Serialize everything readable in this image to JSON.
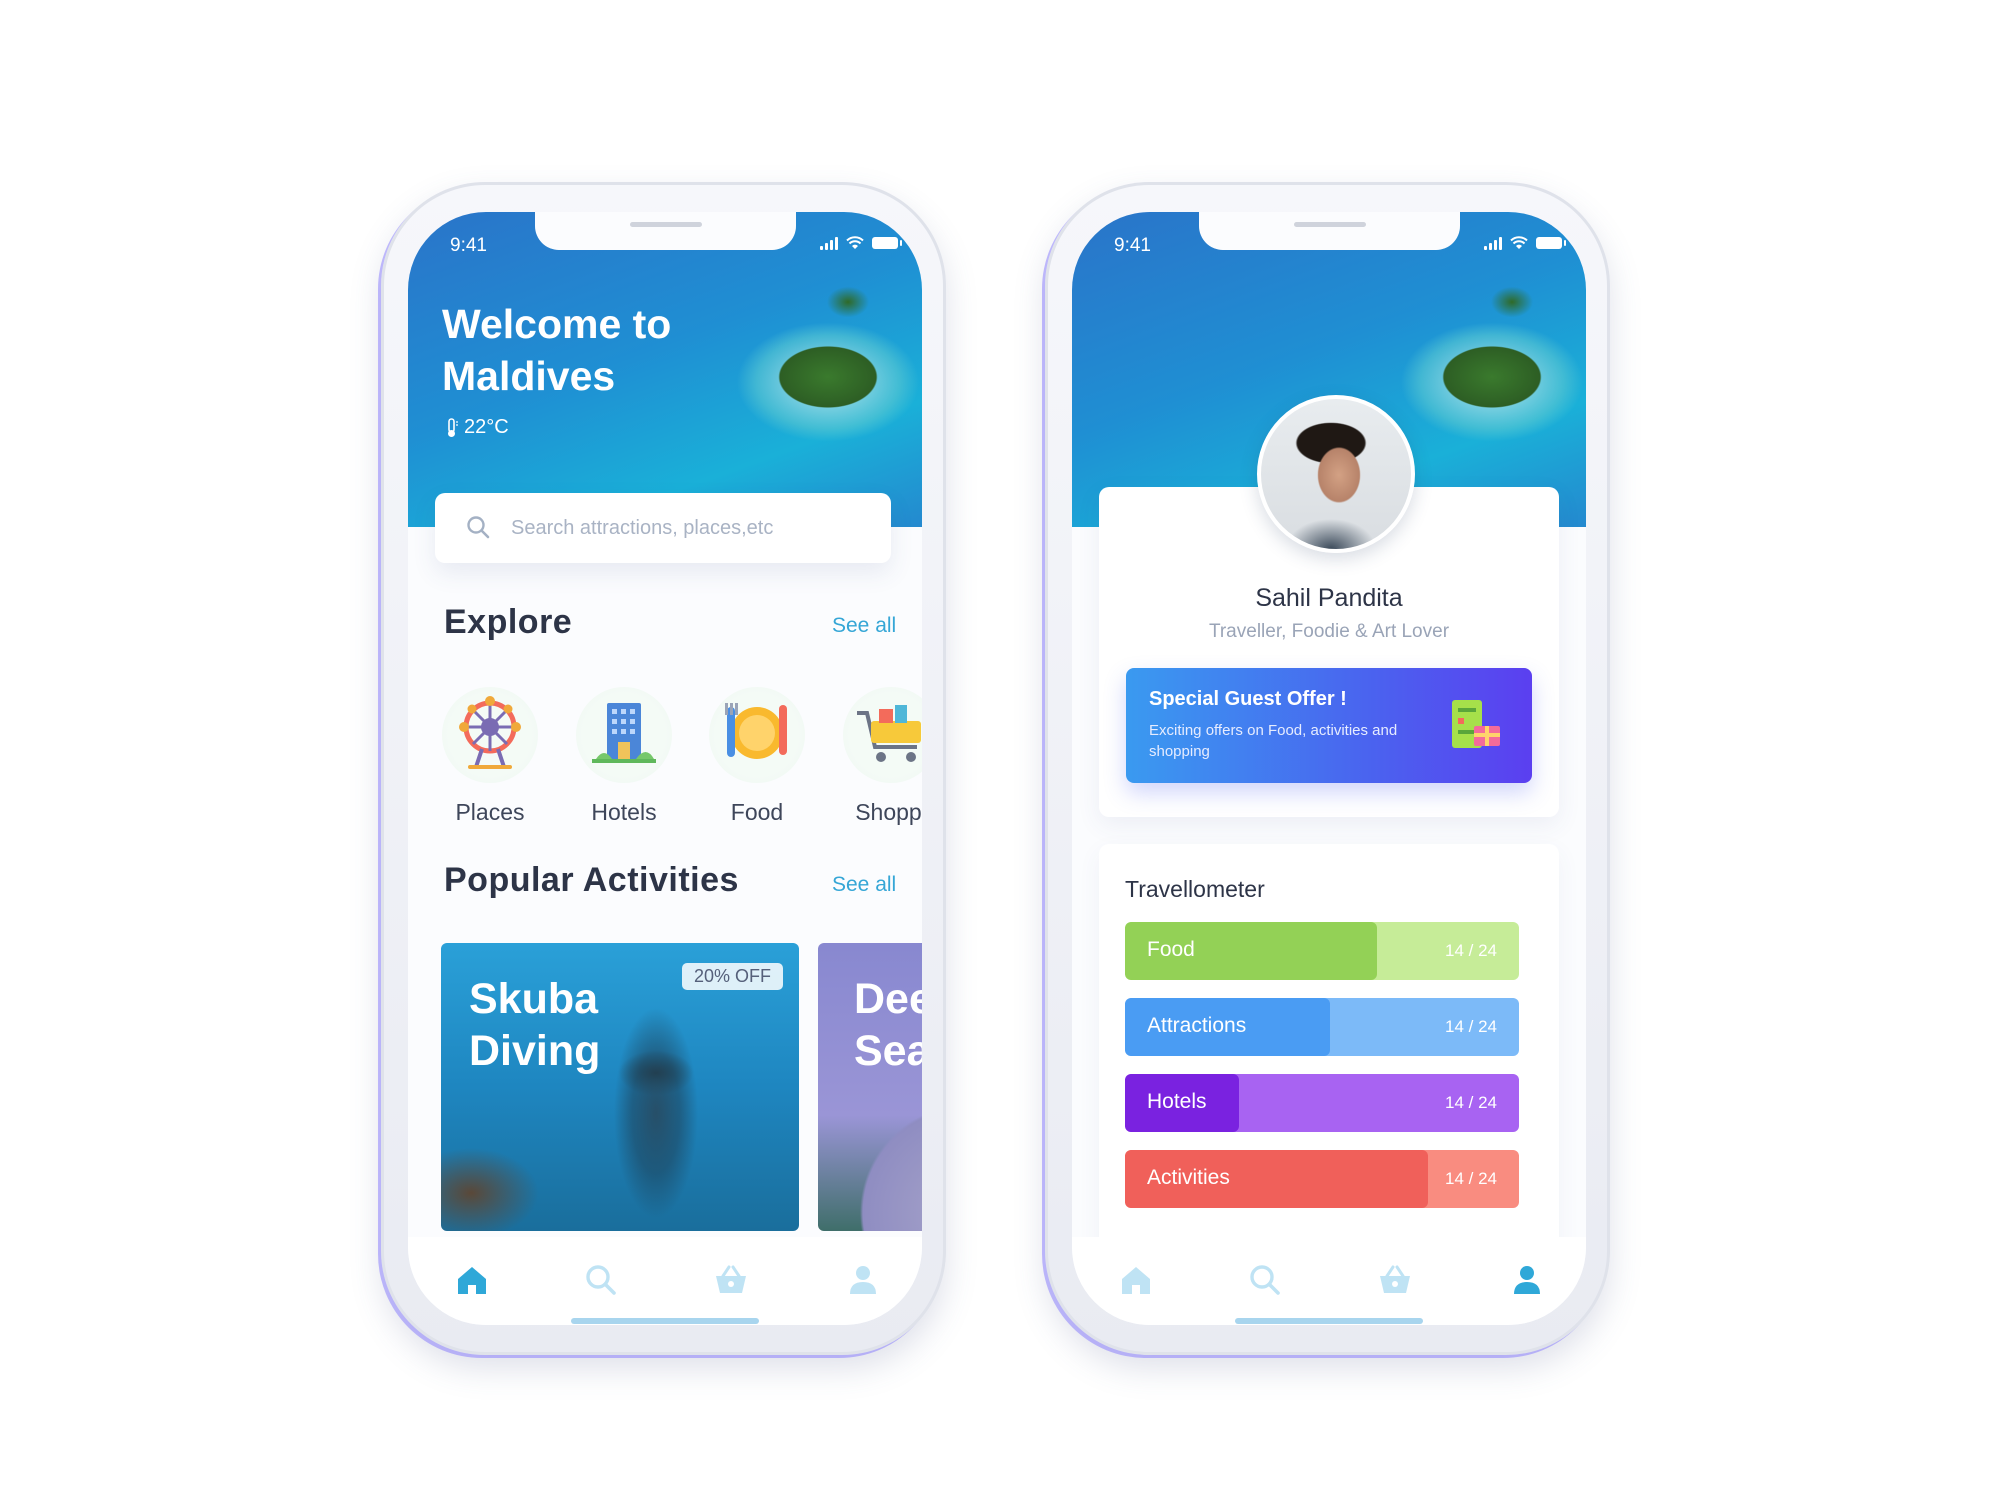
{
  "left_screen": {
    "status_time": "9:41",
    "hero": {
      "title": "Welcome to\nMaldives",
      "temperature": "22°C"
    },
    "search": {
      "placeholder": "Search attractions, places,etc"
    },
    "explore": {
      "title": "Explore",
      "see_all": "See all",
      "categories": [
        {
          "label": "Places",
          "icon": "ferris-wheel-icon"
        },
        {
          "label": "Hotels",
          "icon": "hotel-building-icon"
        },
        {
          "label": "Food",
          "icon": "food-plate-icon"
        },
        {
          "label": "Shoppi",
          "icon": "shopping-cart-icon"
        }
      ]
    },
    "popular": {
      "title": "Popular Activities",
      "see_all": "See all",
      "cards": [
        {
          "title": "Skuba\nDiving",
          "badge": "20% OFF"
        },
        {
          "title": "Dee\nSea"
        }
      ]
    }
  },
  "right_screen": {
    "status_time": "9:41",
    "profile": {
      "name": "Sahil Pandita",
      "bio": "Traveller, Foodie & Art Lover"
    },
    "offer": {
      "title": "Special Guest Offer !",
      "description": "Exciting offers on Food, activities and shopping"
    },
    "travellometer": {
      "title": "Travellometer",
      "items": [
        {
          "label": "Food",
          "count": "14 / 24",
          "progress": 0.64,
          "fill": "#93d156",
          "bg": "#c6ec98"
        },
        {
          "label": "Attractions",
          "count": "14 / 24",
          "progress": 0.52,
          "fill": "#4a9cf3",
          "bg": "#7cbaf8"
        },
        {
          "label": "Hotels",
          "count": "14 / 24",
          "progress": 0.29,
          "fill": "#7a22e0",
          "bg": "#a863f2"
        },
        {
          "label": "Activities",
          "count": "14 / 24",
          "progress": 0.77,
          "fill": "#f0605a",
          "bg": "#f98c80"
        }
      ]
    }
  },
  "colors": {
    "accent": "#35a6d6",
    "tab_active": "#2fa8d8",
    "tab_inactive": "#bfe3f4"
  },
  "tabs": [
    "home-icon",
    "search-icon",
    "basket-icon",
    "profile-icon"
  ]
}
